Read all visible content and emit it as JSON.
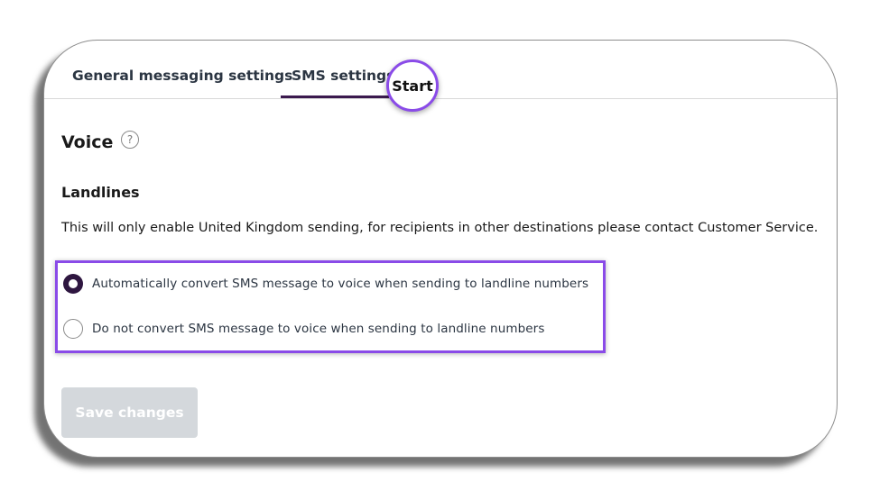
{
  "tabs": [
    {
      "label": "General messaging settings",
      "active": false
    },
    {
      "label": "SMS settings",
      "active": true
    }
  ],
  "start_badge": "Start",
  "section": {
    "title": "Voice",
    "help_icon": "question-mark-circle-icon",
    "help_glyph": "?"
  },
  "landlines": {
    "heading": "Landlines",
    "description": "This will only enable United Kingdom sending, for recipients in other destinations please contact Customer Service.",
    "options": [
      {
        "label": "Automatically convert SMS message to voice when sending to landline numbers",
        "selected": true
      },
      {
        "label": "Do not convert SMS message to voice when sending to landline numbers",
        "selected": false
      }
    ]
  },
  "actions": {
    "save_label": "Save changes",
    "save_enabled": false
  },
  "colors": {
    "accent_highlight": "#8a4be8",
    "active_tab_underline": "#3b1a4e",
    "radio_selected": "#2e1640",
    "button_disabled_bg": "#d4d8dc"
  }
}
